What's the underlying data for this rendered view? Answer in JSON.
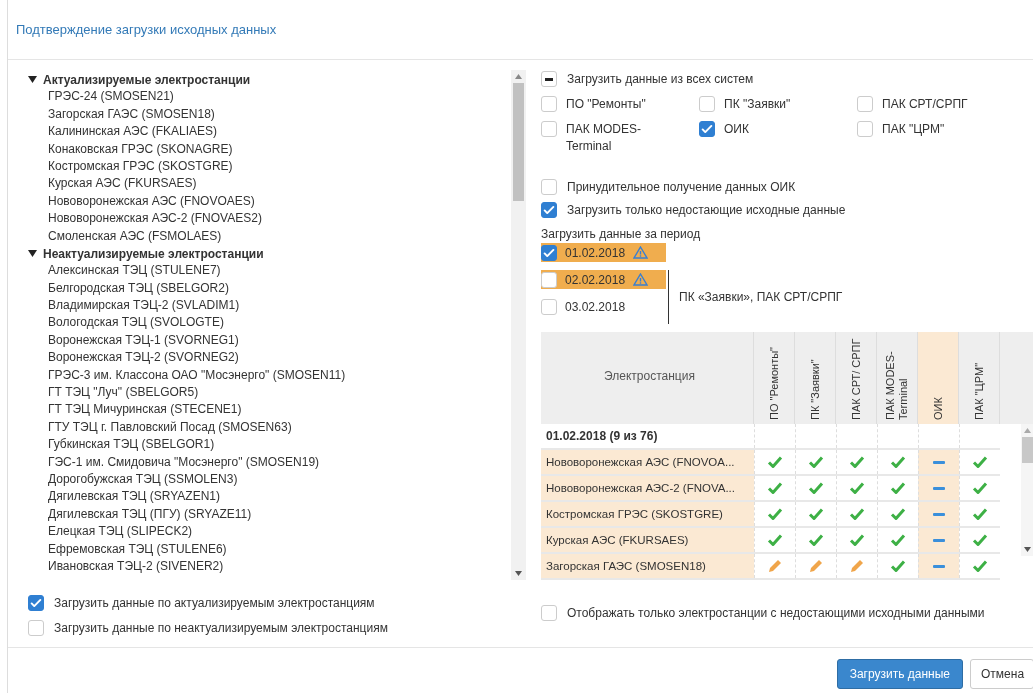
{
  "dialog": {
    "title": "Подтверждение загрузки исходных данных"
  },
  "station_tree": [
    {
      "label": "Актуализируемые электростанции",
      "expanded": true,
      "children": [
        {
          "label": "ГРЭС-24 (SMOSEN21)"
        },
        {
          "label": "Загорская ГАЭС (SMOSEN18)"
        },
        {
          "label": "Калининская АЭС (FKALIAES)"
        },
        {
          "label": "Конаковская ГРЭС (SKONAGRE)"
        },
        {
          "label": "Костромская ГРЭС (SKOSTGRE)"
        },
        {
          "label": "Курская АЭС (FKURSAES)"
        },
        {
          "label": "Нововоронежская АЭС (FNOVOAES)"
        },
        {
          "label": "Нововоронежская АЭС-2 (FNOVAES2)"
        },
        {
          "label": "Смоленская АЭС (FSMOLAES)"
        }
      ]
    },
    {
      "label": "Неактуализируемые электростанции",
      "expanded": true,
      "children": [
        {
          "label": "Алексинская ТЭЦ (STULENE7)"
        },
        {
          "label": "Белгородская ТЭЦ (SBELGOR2)"
        },
        {
          "label": "Владимирская ТЭЦ-2 (SVLADIM1)"
        },
        {
          "label": "Вологодская ТЭЦ (SVOLOGTE)"
        },
        {
          "label": "Воронежская ТЭЦ-1 (SVORNEG1)"
        },
        {
          "label": "Воронежская ТЭЦ-2 (SVORNEG2)"
        },
        {
          "label": "ГРЭС-3 им. Классона ОАО \"Мосэнерго\" (SMOSEN11)"
        },
        {
          "label": "ГТ ТЭЦ \"Луч\" (SBELGOR5)"
        },
        {
          "label": "ГТ ТЭЦ Мичуринская (STECENE1)"
        },
        {
          "label": "ГТУ ТЭЦ г. Павловский Посад (SMOSEN63)"
        },
        {
          "label": "Губкинская ТЭЦ (SBELGOR1)"
        },
        {
          "label": "ГЭС-1 им. Смидовича \"Мосэнерго\" (SMOSEN19)"
        },
        {
          "label": "Дорогобужская ТЭЦ (SSMOLEN3)"
        },
        {
          "label": "Дягилевская ТЭЦ (SRYAZEN1)"
        },
        {
          "label": "Дягилевская ТЭЦ (ПГУ) (SRYAZE11)"
        },
        {
          "label": "Елецкая ТЭЦ (SLIPECK2)"
        },
        {
          "label": "Ефремовская ТЭЦ (STULENE6)"
        },
        {
          "label": "Ивановская ТЭЦ-2 (SIVENER2)"
        }
      ]
    }
  ],
  "station_options": [
    {
      "label": "Загрузить данные по актуализируемым электростанциям",
      "checked": true
    },
    {
      "label": "Загрузить данные по неактуализируемым электростанциям",
      "checked": false
    }
  ],
  "all_systems": {
    "label": "Загрузить данные из всех систем",
    "indeterminate": true
  },
  "systems": [
    {
      "label": "ПО \"Ремонты\"",
      "checked": false
    },
    {
      "label": "ПК \"Заявки\"",
      "checked": false
    },
    {
      "label": "ПАК СРТ/СРПГ",
      "checked": false
    },
    {
      "label": "ПАК MODES-Terminal",
      "checked": false
    },
    {
      "label": "ОИК",
      "checked": true
    },
    {
      "label": "ПАК \"ЦРМ\"",
      "checked": false
    }
  ],
  "load_options": [
    {
      "label": "Принудительное получение данных ОИК",
      "checked": false
    },
    {
      "label": "Загрузить только недостающие исходные данные",
      "checked": true
    }
  ],
  "period": {
    "label": "Загрузить данные за период",
    "dates": [
      {
        "label": "01.02.2018",
        "checked": true,
        "highlighted": true,
        "warning": true
      }
    ],
    "noted_dates": {
      "note": "ПК «Заявки», ПАК СРТ/СРПГ",
      "dates": [
        {
          "label": "02.02.2018",
          "checked": false,
          "highlighted": true,
          "warning": true
        },
        {
          "label": "03.02.2018",
          "checked": false,
          "highlighted": false,
          "warning": false
        }
      ]
    }
  },
  "table": {
    "station_header": "Электростанция",
    "columns": [
      {
        "label": "ПО \"Ремонты\"",
        "highlighted": false
      },
      {
        "label": "ПК \"Заявки\"",
        "highlighted": false
      },
      {
        "label": "ПАК СРТ/ СРПГ",
        "highlighted": false
      },
      {
        "label": "ПАК MODES- Terminal",
        "highlighted": false
      },
      {
        "label": "ОИК",
        "highlighted": true
      },
      {
        "label": "ПАК \"ЦРМ\"",
        "highlighted": false
      }
    ],
    "group": "01.02.2018 (9 из 76)",
    "rows": [
      {
        "station": "Нововоронежская АЭС (FNOVOA...",
        "highlighted": true,
        "cells": [
          {
            "kind": "ok"
          },
          {
            "kind": "ok"
          },
          {
            "kind": "ok"
          },
          {
            "kind": "ok"
          },
          {
            "kind": "none"
          },
          {
            "kind": "ok"
          }
        ]
      },
      {
        "station": "Нововоронежская АЭС-2 (FNOVA...",
        "highlighted": true,
        "cells": [
          {
            "kind": "ok"
          },
          {
            "kind": "ok"
          },
          {
            "kind": "ok"
          },
          {
            "kind": "ok"
          },
          {
            "kind": "none"
          },
          {
            "kind": "ok"
          }
        ]
      },
      {
        "station": "Костромская ГРЭС (SKOSTGRE)",
        "highlighted": true,
        "cells": [
          {
            "kind": "ok"
          },
          {
            "kind": "ok"
          },
          {
            "kind": "ok"
          },
          {
            "kind": "ok"
          },
          {
            "kind": "none"
          },
          {
            "kind": "ok"
          }
        ]
      },
      {
        "station": "Курская АЭС (FKURSAES)",
        "highlighted": true,
        "cells": [
          {
            "kind": "ok"
          },
          {
            "kind": "ok"
          },
          {
            "kind": "ok"
          },
          {
            "kind": "ok"
          },
          {
            "kind": "none"
          },
          {
            "kind": "ok"
          }
        ]
      },
      {
        "station": "Загорская ГАЭС (SMOSEN18)",
        "highlighted": true,
        "cells": [
          {
            "kind": "edit"
          },
          {
            "kind": "edit"
          },
          {
            "kind": "edit"
          },
          {
            "kind": "ok"
          },
          {
            "kind": "none"
          },
          {
            "kind": "ok"
          }
        ]
      }
    ]
  },
  "filter_option": {
    "label": "Отображать только электростанции с недостающими исходными данными",
    "checked": false
  },
  "buttons": [
    {
      "label": "Загрузить данные",
      "kind": "primary"
    },
    {
      "label": "Отмена",
      "kind": "default"
    }
  ]
}
